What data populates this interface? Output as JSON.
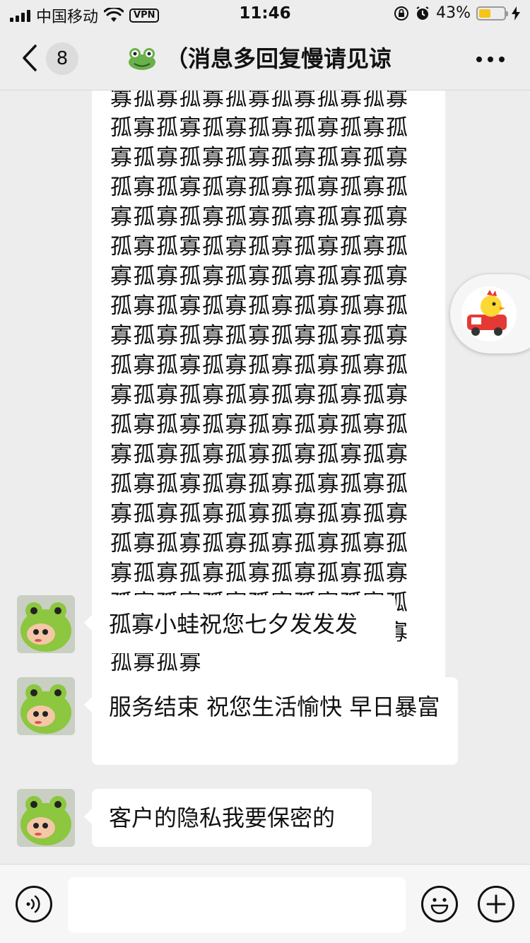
{
  "status_bar": {
    "carrier": "中国移动",
    "vpn": "VPN",
    "time": "11:46",
    "battery": "43%"
  },
  "nav": {
    "unread_count": "8",
    "title": "（消息多回复慢请见谅"
  },
  "messages": [
    {
      "id": "m1",
      "text": "寡孤寡孤寡孤寡孤寡孤寡孤寡孤寡孤寡孤寡孤寡孤寡孤寡孤寡孤寡孤寡孤寡孤寡孤寡孤寡孤寡孤寡孤寡孤寡孤寡孤寡孤寡孤寡孤寡孤寡孤寡孤寡孤寡孤寡孤寡孤寡孤寡孤寡孤寡孤寡孤寡孤寡孤寡孤寡孤寡孤寡孤寡孤寡孤寡孤寡孤寡孤寡孤寡孤寡孤寡孤寡孤寡孤寡孤寡孤寡孤寡孤寡孤寡孤寡孤寡孤寡孤寡孤寡孤寡孤寡孤寡孤寡孤寡孤寡孤寡孤寡孤寡孤寡孤寡孤寡孤寡孤寡孤寡孤寡孤寡孤寡孤寡孤寡孤寡孤寡孤寡孤寡孤寡孤寡孤寡孤寡孤寡孤寡孤寡孤寡孤寡孤寡孤寡孤寡孤寡孤寡孤寡孤寡孤寡孤寡孤寡孤寡孤寡孤寡孤寡孤寡孤寡孤寡孤寡孤寡孤寡孤寡孤寡孤寡孤寡孤寡"
    },
    {
      "id": "m2",
      "text": "孤寡小蛙祝您七夕发发发"
    },
    {
      "id": "m3",
      "text": "服务结束 祝您生活愉快 早日暴富"
    },
    {
      "id": "m4",
      "text": "客户的隐私我要保密的"
    }
  ],
  "input": {
    "value": ""
  },
  "icons": {
    "back": "chevron-left-icon",
    "more": "ellipsis-icon",
    "voice": "voice-icon",
    "emoji": "emoji-icon",
    "plus": "plus-icon"
  },
  "colors": {
    "background": "#ededed",
    "bubble": "#ffffff",
    "battery": "#f5c518"
  }
}
